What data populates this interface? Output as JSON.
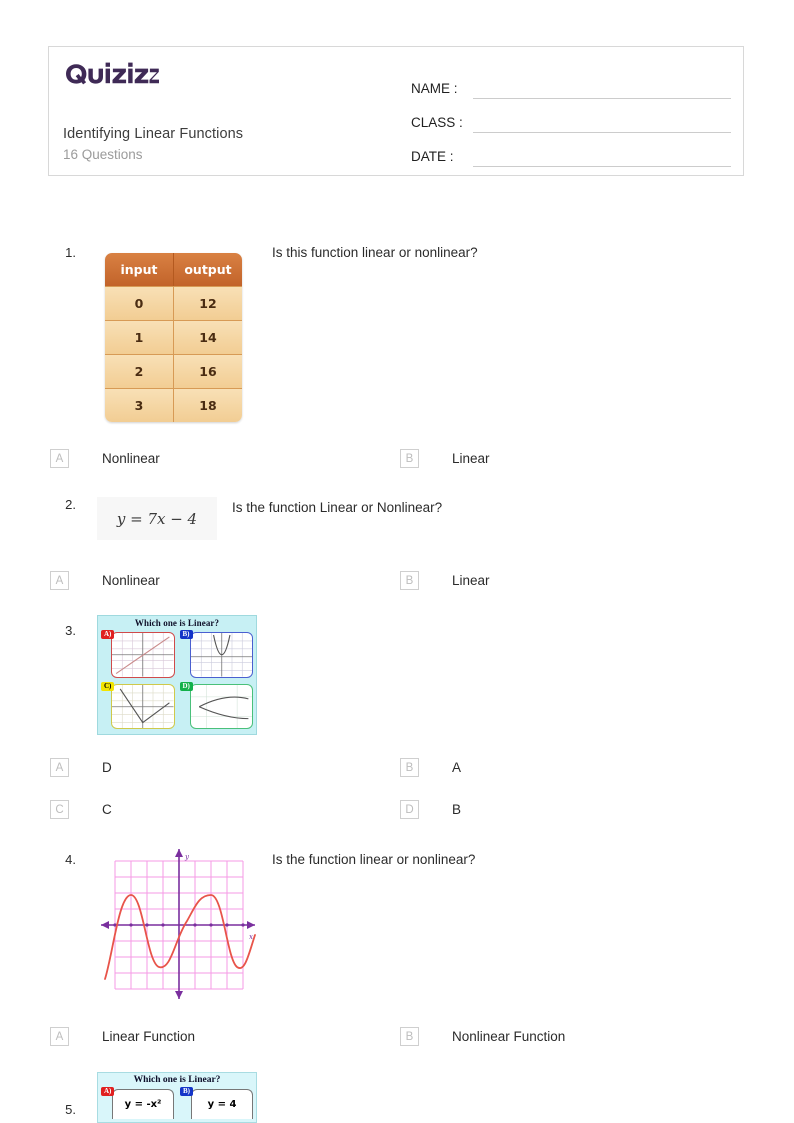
{
  "header": {
    "logo_text": "Quizizz",
    "logo_color": "#3f2a56",
    "title": "Identifying Linear Functions",
    "subtitle": "16 Questions",
    "fields": [
      {
        "label": "NAME :",
        "value": ""
      },
      {
        "label": "CLASS :",
        "value": ""
      },
      {
        "label": "DATE  :",
        "value": ""
      }
    ]
  },
  "questions": [
    {
      "number": "1.",
      "text": "Is this function linear or nonlinear?",
      "table": {
        "headers": [
          "input",
          "output"
        ],
        "rows": [
          [
            "0",
            "12"
          ],
          [
            "1",
            "14"
          ],
          [
            "2",
            "16"
          ],
          [
            "3",
            "18"
          ]
        ]
      },
      "options": [
        {
          "letter": "A",
          "text": "Nonlinear"
        },
        {
          "letter": "B",
          "text": "Linear"
        }
      ]
    },
    {
      "number": "2.",
      "text": "Is the function Linear or Nonlinear?",
      "formula": "y = 7x − 4",
      "options": [
        {
          "letter": "A",
          "text": "Nonlinear"
        },
        {
          "letter": "B",
          "text": "Linear"
        }
      ]
    },
    {
      "number": "3.",
      "text": "",
      "image": {
        "title": "Which one is Linear?",
        "cells": [
          {
            "badge": "A)",
            "badge_color": "#e02020",
            "frame_color": "#d04a4a",
            "graph": "diagonal-line"
          },
          {
            "badge": "B)",
            "badge_color": "#1434c8",
            "frame_color": "#4a5fd0",
            "graph": "parabola-up"
          },
          {
            "badge": "C)",
            "badge_color": "#f2e400",
            "badge_text_color": "#000000",
            "frame_color": "#cfc94a",
            "graph": "v-shape"
          },
          {
            "badge": "D)",
            "badge_color": "#12b04a",
            "frame_color": "#4ac07a",
            "graph": "sideways-parabola"
          }
        ]
      },
      "options": [
        {
          "letter": "A",
          "text": "D"
        },
        {
          "letter": "B",
          "text": "A"
        },
        {
          "letter": "C",
          "text": "C"
        },
        {
          "letter": "D",
          "text": "B"
        }
      ]
    },
    {
      "number": "4.",
      "text": "Is the function linear or nonlinear?",
      "image": {
        "graph": "sine-wave",
        "axis_labels": {
          "x": "x",
          "y": "y"
        },
        "grid_color": "#f07fe0",
        "axis_color": "#7a2f9e",
        "curve_color": "#e8544a"
      },
      "options": [
        {
          "letter": "A",
          "text": "Linear Function"
        },
        {
          "letter": "B",
          "text": "Nonlinear Function"
        }
      ]
    },
    {
      "number": "5.",
      "text": "",
      "image": {
        "title": "Which one is Linear?",
        "cells": [
          {
            "badge": "A)",
            "badge_color": "#e02020",
            "equation": "y = -x²"
          },
          {
            "badge": "B)",
            "badge_color": "#1434c8",
            "equation": "y = 4"
          }
        ]
      },
      "options": []
    }
  ]
}
